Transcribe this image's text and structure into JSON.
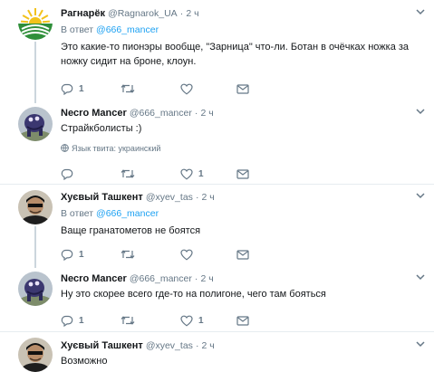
{
  "tweets": [
    {
      "name": "Рагнарёк",
      "handle": "@Ragnarok_UA",
      "time": "2 ч",
      "reply_prefix": "В ответ",
      "reply_to": "@666_mancer",
      "text_lines": [
        "Это какие-то пионэры вообще, \"Зарница\" что-ли. Ботан в очёчках ножка за",
        "ножку сидит на броне, клоун."
      ],
      "reply_count": "1",
      "like_count": ""
    },
    {
      "name": "Necro Mancer",
      "handle": "@666_mancer",
      "time": "2 ч",
      "text_lines": [
        "Страйкболисты :)"
      ],
      "language_note": "Язык твита: украинский",
      "reply_count": "",
      "like_count": "1"
    },
    {
      "name": "Хуєвый Ташкент",
      "handle": "@xyev_tas",
      "time": "2 ч",
      "reply_prefix": "В ответ",
      "reply_to": "@666_mancer",
      "text_lines": [
        "Ваще гранатометов не боятся"
      ],
      "reply_count": "1",
      "like_count": ""
    },
    {
      "name": "Necro Mancer",
      "handle": "@666_mancer",
      "time": "2 ч",
      "text_lines": [
        "Ну это скорее всего где-то на полигоне, чего там бояться"
      ],
      "reply_count": "1",
      "like_count": "1"
    },
    {
      "name": "Хуєвый Ташкент",
      "handle": "@xyev_tas",
      "time": "2 ч",
      "text_lines": [
        "Возможно"
      ]
    }
  ],
  "icons": {
    "reply": "reply-icon",
    "retweet": "retweet-icon",
    "like": "heart-icon",
    "dm": "envelope-icon",
    "more": "chevron-down-icon",
    "globe": "globe-icon"
  },
  "colors": {
    "name": "#14171a",
    "meta": "#657786",
    "link": "#1da1f2",
    "divider": "#e6ecf0",
    "thread_line": "#ccd6dd"
  }
}
